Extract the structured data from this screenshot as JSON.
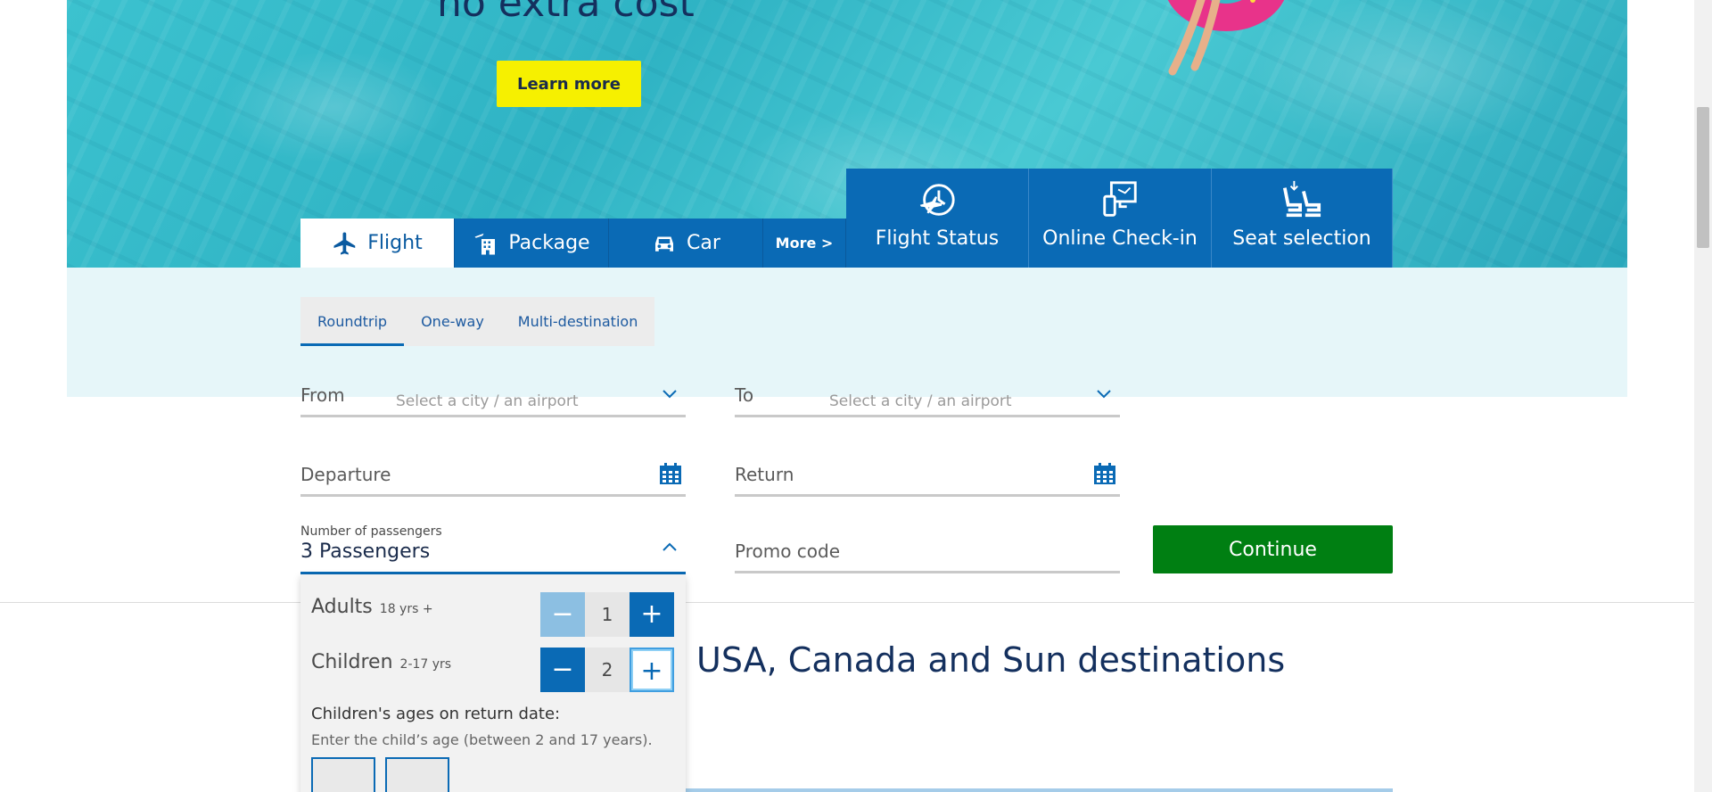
{
  "hero": {
    "title": "no extra cost",
    "learn_more_label": "Learn more"
  },
  "tabs": [
    {
      "label": "Flight",
      "icon": "airplane-icon",
      "active": true
    },
    {
      "label": "Package",
      "icon": "package-icon",
      "active": false
    },
    {
      "label": "Car",
      "icon": "car-icon",
      "active": false
    },
    {
      "label": "More >",
      "active": false
    }
  ],
  "services": [
    {
      "label": "Flight Status",
      "icon": "flight-status-icon"
    },
    {
      "label": "Online Check-in",
      "icon": "online-checkin-icon"
    },
    {
      "label": "Seat selection",
      "icon": "seat-selection-icon"
    }
  ],
  "trip_type": {
    "options": [
      "Roundtrip",
      "One-way",
      "Multi-destination"
    ],
    "selected": "Roundtrip"
  },
  "form": {
    "from_label": "From",
    "from_placeholder": "Select a city / an airport",
    "to_label": "To",
    "to_placeholder": "Select a city / an airport",
    "departure_label": "Departure",
    "return_label": "Return",
    "passengers_label": "Number of passengers",
    "passengers_value": "3 Passengers",
    "promo_label": "Promo code",
    "continue_label": "Continue"
  },
  "passengers": {
    "adults": {
      "label": "Adults",
      "age": "18 yrs +",
      "count": "1"
    },
    "children": {
      "label": "Children",
      "age": "2-17 yrs",
      "count": "2"
    },
    "minus_symbol": "−",
    "plus_symbol": "+",
    "ages_title": "Children's ages on return date:",
    "ages_help": "Enter the child’s age (between 2 and 17 years)."
  },
  "destinations": {
    "title": "USA, Canada and Sun destinations"
  },
  "colors": {
    "brand_blue": "#0a6ab5",
    "continue_green": "#007f12",
    "learn_more_yellow": "#f6f000",
    "navy_text": "#14305e"
  }
}
